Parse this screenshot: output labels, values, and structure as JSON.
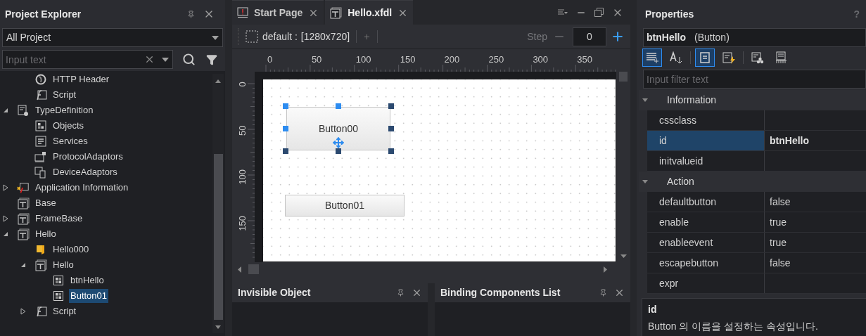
{
  "project_explorer": {
    "title": "Project Explorer",
    "scope": "All Project",
    "search": {
      "placeholder": "Input text"
    },
    "tree": {
      "continued_items": [
        {
          "label": "HTTP Header",
          "kind": "globe",
          "selected": false
        },
        {
          "label": "Script",
          "kind": "script",
          "selected": false
        }
      ],
      "items": [
        {
          "label": "TypeDefinition",
          "kind": "typedef",
          "expanded": true,
          "selected": false,
          "children": [
            {
              "label": "Objects",
              "kind": "objects",
              "selected": false
            },
            {
              "label": "Services",
              "kind": "services",
              "selected": false
            },
            {
              "label": "ProtocolAdaptors",
              "kind": "protocol",
              "selected": false
            },
            {
              "label": "DeviceAdaptors",
              "kind": "device",
              "selected": false
            }
          ]
        },
        {
          "label": "Application Information",
          "kind": "appinfo",
          "expanded": false,
          "selected": false
        },
        {
          "label": "Base",
          "kind": "form",
          "selected": false
        },
        {
          "label": "FrameBase",
          "kind": "form",
          "expanded": false,
          "selected": false
        },
        {
          "label": "Hello",
          "kind": "form",
          "expanded": true,
          "selected": false,
          "children": [
            {
              "label": "Hello000",
              "kind": "folder",
              "selected": false
            },
            {
              "label": "Hello",
              "kind": "form",
              "expanded": true,
              "selected": false,
              "children": [
                {
                  "label": "btnHello",
                  "kind": "control",
                  "selected": false
                },
                {
                  "label": "Button01",
                  "kind": "control",
                  "selected": true
                }
              ]
            },
            {
              "label": "Script",
              "kind": "script",
              "expanded": false,
              "selected": false
            }
          ]
        }
      ]
    }
  },
  "editor": {
    "tabs": [
      {
        "label": "Start Page",
        "kind": "alert",
        "selected": false
      },
      {
        "label": "Hello.xfdl",
        "kind": "form",
        "selected": true
      }
    ],
    "toolbar": {
      "screen": "default :",
      "size": "[1280x720]",
      "step_label": "Step",
      "step_value": "0"
    },
    "ruler": {
      "x_labels": [
        "0",
        "50",
        "100",
        "150",
        "200",
        "250",
        "300",
        "350"
      ],
      "y_labels": [
        "0",
        "50",
        "100",
        "150"
      ]
    },
    "canvas": {
      "components": [
        {
          "label": "Button00",
          "selected": true
        },
        {
          "label": "Button01",
          "selected": false
        }
      ]
    }
  },
  "invisible_object": {
    "title": "Invisible Object"
  },
  "binding_components": {
    "title": "Binding Components List"
  },
  "properties": {
    "title": "Properties",
    "help": "?",
    "object_name": "btnHello",
    "object_type": "(Button)",
    "toolbar": [
      {
        "kind": "categorized",
        "selected": true
      },
      {
        "kind": "alphabetical",
        "selected": false
      },
      {
        "kind": "properties",
        "selected": true
      },
      {
        "kind": "events",
        "selected": false
      },
      {
        "kind": "binding",
        "selected": false
      },
      {
        "kind": "init",
        "selected": false
      }
    ],
    "filter": {
      "placeholder": "Input filter text"
    },
    "groups": [
      {
        "label": "Information",
        "expanded": true,
        "rows": [
          {
            "name": "cssclass",
            "selected": false
          },
          {
            "name": "id",
            "value": "btnHello",
            "selected": true
          },
          {
            "name": "initvalueid",
            "selected": false
          }
        ]
      },
      {
        "label": "Action",
        "expanded": true,
        "rows": [
          {
            "name": "defaultbutton",
            "value": "false",
            "selected": false
          },
          {
            "name": "enable",
            "value": "true",
            "selected": false
          },
          {
            "name": "enableevent",
            "value": "true",
            "selected": false
          },
          {
            "name": "escapebutton",
            "value": "false",
            "selected": false
          },
          {
            "name": "expr",
            "selected": false
          }
        ]
      }
    ],
    "description": {
      "title": "id",
      "text": "Button 의 이름을 설정하는 속성입니다."
    }
  }
}
